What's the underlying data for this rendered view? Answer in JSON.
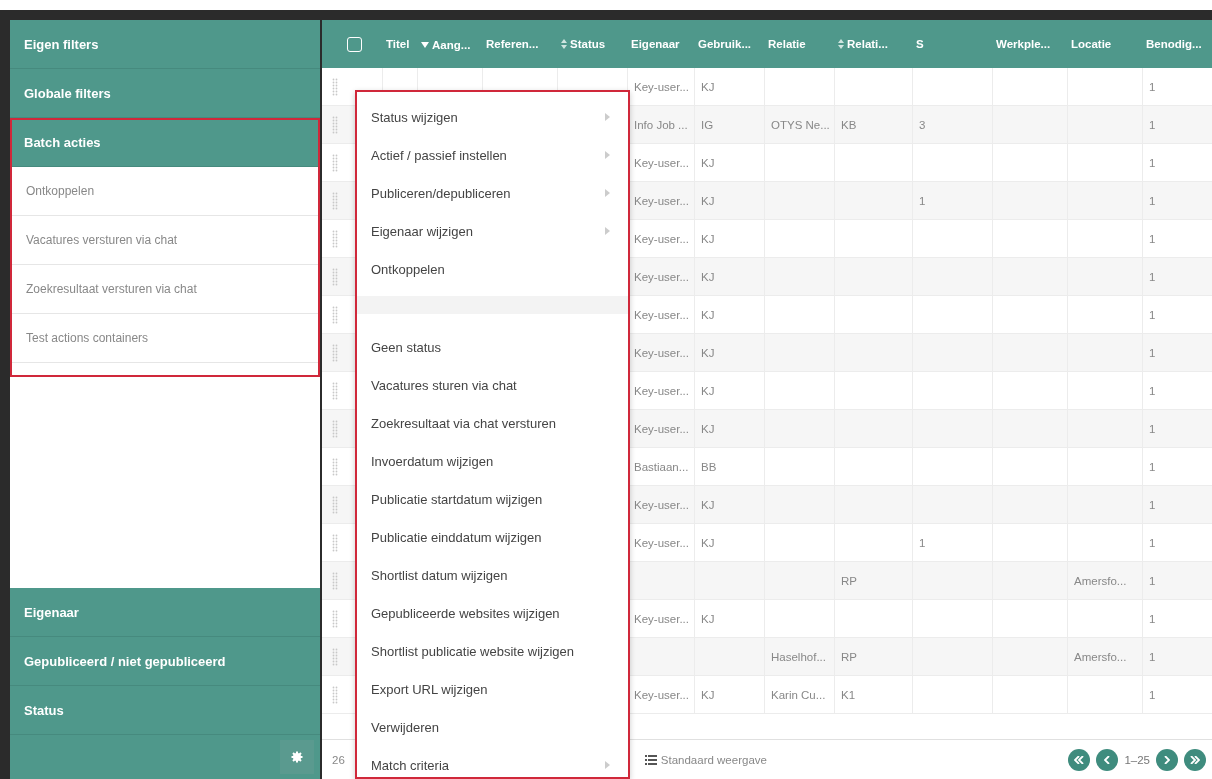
{
  "sidebar": {
    "sections": [
      {
        "label": "Eigen filters"
      },
      {
        "label": "Globale filters"
      },
      {
        "label": "Batch acties",
        "expanded": true,
        "highlighted": true,
        "items": [
          "Ontkoppelen",
          "Vacatures versturen via chat",
          "Zoekresultaat versturen via chat",
          "Test actions containers"
        ]
      }
    ],
    "bottom_sections": [
      {
        "label": "Eigenaar"
      },
      {
        "label": "Gepubliceerd / niet gepubliceerd"
      },
      {
        "label": "Status"
      }
    ]
  },
  "table": {
    "select_all": {
      "checked": false
    },
    "columns": [
      {
        "label": "Titel"
      },
      {
        "label": "Aang...",
        "sorted_descending": true
      },
      {
        "label": "Referen..."
      },
      {
        "label": "Status",
        "sortable": true
      },
      {
        "label": "Eigenaar"
      },
      {
        "label": "Gebruik..."
      },
      {
        "label": "Relatie"
      },
      {
        "label": "Relati...",
        "sortable": true
      },
      {
        "label": "S"
      },
      {
        "label": "Werkple..."
      },
      {
        "label": "Locatie"
      },
      {
        "label": "Benodig..."
      }
    ],
    "rows": [
      {
        "eigenaar": "Key-user...",
        "gebruik": "KJ",
        "benodig": "1"
      },
      {
        "eigenaar": "Info Job ...",
        "gebruik": "IG",
        "relatie": "OTYS Ne...",
        "relati": "KB",
        "s": "3",
        "benodig": "1"
      },
      {
        "eigenaar": "Key-user...",
        "gebruik": "KJ",
        "benodig": "1"
      },
      {
        "eigenaar": "Key-user...",
        "gebruik": "KJ",
        "s": "1",
        "benodig": "1"
      },
      {
        "eigenaar": "Key-user...",
        "gebruik": "KJ",
        "benodig": "1"
      },
      {
        "eigenaar": "Key-user...",
        "gebruik": "KJ",
        "benodig": "1"
      },
      {
        "eigenaar": "Key-user...",
        "gebruik": "KJ",
        "benodig": "1"
      },
      {
        "eigenaar": "Key-user...",
        "gebruik": "KJ",
        "benodig": "1"
      },
      {
        "eigenaar": "Key-user...",
        "gebruik": "KJ",
        "benodig": "1"
      },
      {
        "eigenaar": "Key-user...",
        "gebruik": "KJ",
        "benodig": "1"
      },
      {
        "eigenaar": "Bastiaan...",
        "gebruik": "BB",
        "benodig": "1"
      },
      {
        "eigenaar": "Key-user...",
        "gebruik": "KJ",
        "benodig": "1"
      },
      {
        "eigenaar": "Key-user...",
        "gebruik": "KJ",
        "s": "1",
        "benodig": "1"
      },
      {
        "relati": "RP",
        "locatie": "Amersfo...",
        "benodig": "1"
      },
      {
        "eigenaar": "Key-user...",
        "gebruik": "KJ",
        "benodig": "1"
      },
      {
        "relatie": "Haselhof...",
        "relati": "RP",
        "locatie": "Amersfo...",
        "benodig": "1"
      },
      {
        "eigenaar": "Key-user...",
        "gebruik": "KJ",
        "relatie": "Karin Cu...",
        "relati": "K1",
        "benodig": "1"
      }
    ]
  },
  "context_menu": {
    "highlighted": true,
    "items": [
      {
        "kind": "submenu",
        "label": "Status wijzigen"
      },
      {
        "kind": "submenu",
        "label": "Actief / passief instellen"
      },
      {
        "kind": "submenu",
        "label": "Publiceren/depubliceren"
      },
      {
        "kind": "submenu",
        "label": "Eigenaar wijzigen"
      },
      {
        "kind": "action",
        "label": "Ontkoppelen"
      },
      {
        "kind": "separator"
      },
      {
        "kind": "action",
        "label": "Geen status"
      },
      {
        "kind": "action",
        "label": "Vacatures sturen via chat"
      },
      {
        "kind": "action",
        "label": "Zoekresultaat via chat versturen"
      },
      {
        "kind": "action",
        "label": "Invoerdatum wijzigen"
      },
      {
        "kind": "action",
        "label": "Publicatie startdatum wijzigen"
      },
      {
        "kind": "action",
        "label": "Publicatie einddatum wijzigen"
      },
      {
        "kind": "action",
        "label": "Shortlist datum wijzigen"
      },
      {
        "kind": "action",
        "label": "Gepubliceerde websites wijzigen"
      },
      {
        "kind": "action",
        "label": "Shortlist publicatie website wijzigen"
      },
      {
        "kind": "action",
        "label": "Export URL wijzigen"
      },
      {
        "kind": "action",
        "label": "Verwijderen"
      },
      {
        "kind": "submenu",
        "label": "Match criteria"
      }
    ]
  },
  "footer": {
    "count": "26",
    "view": "Standaard weergave",
    "range": "1–25"
  }
}
